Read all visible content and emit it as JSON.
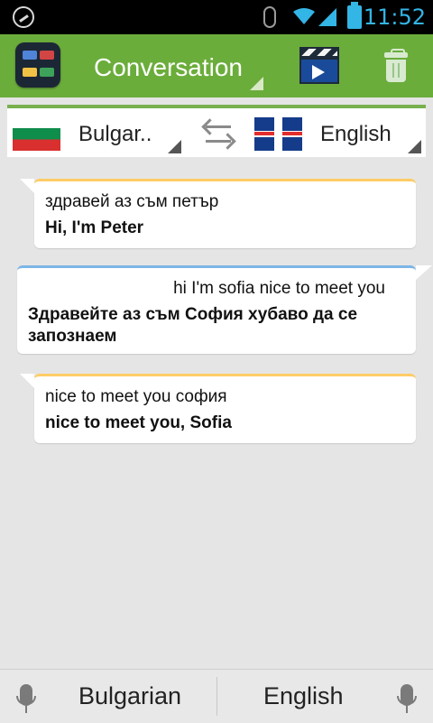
{
  "statusbar": {
    "time": "11:52",
    "icons": [
      "app-status-icon",
      "bluetooth-icon",
      "wifi-icon",
      "signal-icon",
      "battery-icon"
    ]
  },
  "appbar": {
    "app_icon": "flags-app-icon",
    "title": "Conversation",
    "video_icon": "video-clapper-icon",
    "trash_icon": "trash-icon",
    "accent": "#6bad3b"
  },
  "languages": {
    "left": {
      "flag": "bulgaria-flag-icon",
      "label": "Bulgar.."
    },
    "swap_icon": "swap-arrows-icon",
    "right": {
      "flag": "uk-flag-icon",
      "label": "English"
    }
  },
  "conversation": [
    {
      "source": "здравей аз съм петър",
      "translation": "Hi, I'm Peter"
    },
    {
      "source": "hi I'm sofia nice to meet you",
      "translation": "Здравейте аз съм София хубаво да се запознаем"
    },
    {
      "source": "nice to meet you софия",
      "translation": "nice to meet you, Sofia"
    }
  ],
  "bottom": {
    "left_label": "Bulgarian",
    "right_label": "English",
    "mic_icon": "microphone-icon"
  }
}
